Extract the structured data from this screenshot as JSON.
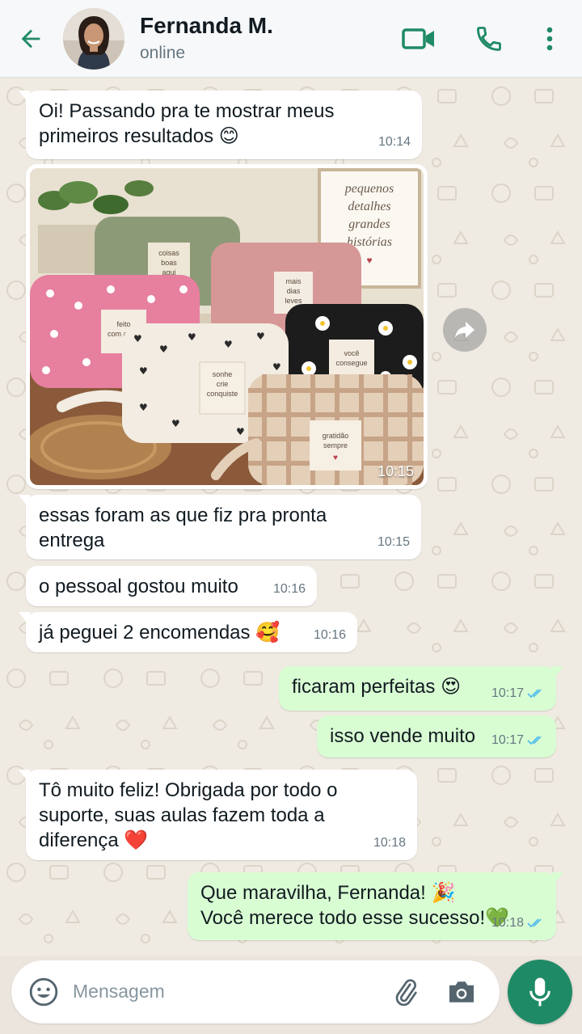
{
  "header": {
    "contact_name": "Fernanda M.",
    "status": "online",
    "icons": [
      "back-arrow-icon",
      "video-call-icon",
      "voice-call-icon",
      "more-options-icon"
    ]
  },
  "messages": [
    {
      "dir": "in",
      "text_line1": "Oi! Passando pra te mostrar meus",
      "text_line2": "primeiros resultados",
      "emoji": "😊",
      "time": "10:14"
    },
    {
      "dir": "in",
      "type": "image",
      "time": "10:15",
      "sign_lines": [
        "pequenos",
        "detalhes",
        "grandes",
        "histórias"
      ],
      "bag_labels": [
        [
          "coisas",
          "boas",
          "aqui"
        ],
        [
          "mais",
          "dias",
          "leves"
        ],
        [
          "feito",
          "com amor"
        ],
        [
          "você",
          "consegue"
        ],
        [
          "sonhe",
          "crie",
          "conquiste"
        ],
        [
          "gratidão",
          "sempre"
        ]
      ]
    },
    {
      "dir": "in",
      "text_line1": "essas foram as que fiz pra pronta",
      "text_line2": "entrega",
      "time": "10:15"
    },
    {
      "dir": "in",
      "text": "o pessoal gostou muito",
      "time": "10:16"
    },
    {
      "dir": "in",
      "text": "já peguei 2 encomendas",
      "emoji": "🥰",
      "time": "10:16"
    },
    {
      "dir": "out",
      "text": "ficaram perfeitas",
      "emoji": "😍",
      "time": "10:17",
      "status": "read"
    },
    {
      "dir": "out",
      "text": "isso vende muito",
      "time": "10:17",
      "status": "read"
    },
    {
      "dir": "in",
      "text_line1": "Tô muito feliz! Obrigada por todo o",
      "text_line2": "suporte, suas aulas fazem toda a",
      "text_line3": "diferença",
      "emoji": "❤️",
      "time": "10:18"
    },
    {
      "dir": "out",
      "text_line1": "Que maravilha, Fernanda!",
      "emoji1": "🎉",
      "text_line2": "Você merece todo esse sucesso!",
      "emoji2": "💚",
      "time": "10:18",
      "status": "read"
    }
  ],
  "composer": {
    "placeholder": "Mensagem",
    "icons": [
      "emoji-icon",
      "attach-icon",
      "camera-icon",
      "mic-icon"
    ]
  },
  "colors": {
    "accent": "#1f8a66",
    "outgoing_bubble": "#d9fdd3",
    "incoming_bubble": "#ffffff",
    "chat_background": "#efeae2",
    "read_ticks": "#53bdeb"
  }
}
